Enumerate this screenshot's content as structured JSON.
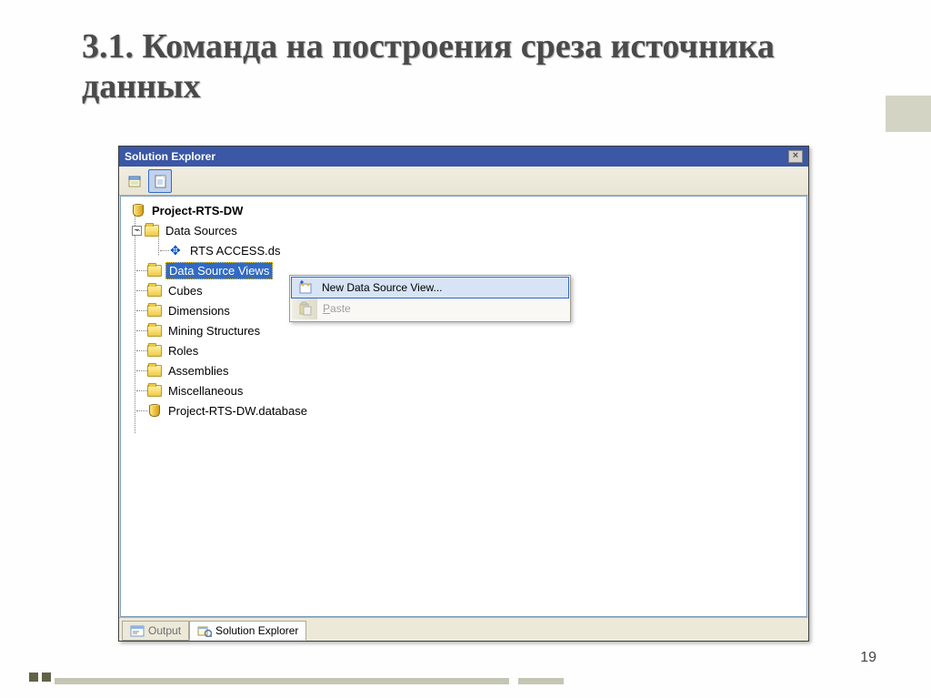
{
  "slide": {
    "title": "3.1. Команда на построения среза источника данных",
    "page_number": "19"
  },
  "panel": {
    "title": "Solution Explorer"
  },
  "tree": {
    "project": "Project-RTS-DW",
    "data_sources": "Data Sources",
    "rts_access": "RTS ACCESS.ds",
    "data_source_views": "Data Source Views",
    "cubes": "Cubes",
    "dimensions": "Dimensions",
    "mining_structures": "Mining Structures",
    "roles": "Roles",
    "assemblies": "Assemblies",
    "miscellaneous": "Miscellaneous",
    "project_db": "Project-RTS-DW.database"
  },
  "context_menu": {
    "new_dsv": "New Data Source View...",
    "paste": "Paste"
  },
  "tabs": {
    "output": "Output",
    "solution_explorer": "Solution Explorer"
  }
}
